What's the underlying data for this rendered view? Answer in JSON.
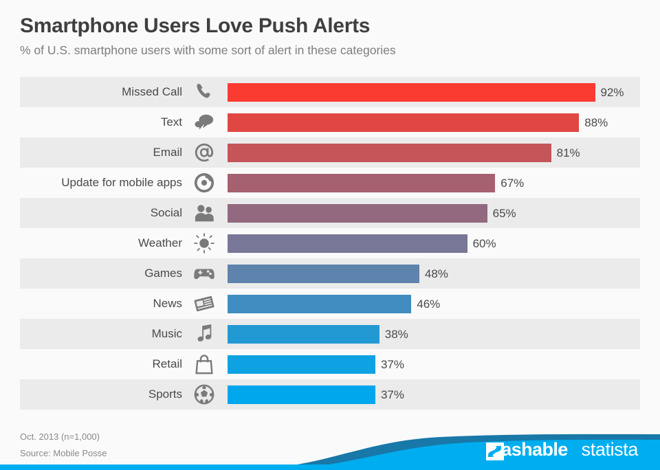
{
  "header": {
    "title": "Smartphone Users Love Push Alerts",
    "subtitle": "% of U.S. smartphone users with some sort of alert in these categories"
  },
  "footer": {
    "date_note": "Oct. 2013 (n=1,000)",
    "source": "Source: Mobile Posse",
    "mashable_label": "Mashable",
    "statista_label": "statista"
  },
  "colors": {
    "background": "#FAFAFA",
    "row_stripe": "#EBEBEB",
    "title": "#3F3F3F",
    "subtitle": "#7D7D7D",
    "label": "#4A4A4A",
    "icon": "#7A7A7A",
    "banner_light": "#00AEEF",
    "banner_dark": "#1878A8"
  },
  "chart_data": {
    "type": "bar",
    "orientation": "horizontal",
    "title": "Smartphone Users Love Push Alerts",
    "subtitle": "% of U.S. smartphone users with some sort of alert in these categories",
    "xlabel": "",
    "ylabel": "",
    "xlim": [
      0,
      100
    ],
    "unit": "%",
    "grid": false,
    "legend": "none",
    "categories": [
      "Missed Call",
      "Text",
      "Email",
      "Update for mobile apps",
      "Social",
      "Weather",
      "Games",
      "News",
      "Music",
      "Retail",
      "Sports"
    ],
    "values": [
      92,
      88,
      81,
      67,
      65,
      60,
      48,
      46,
      38,
      37,
      37
    ],
    "value_labels": [
      "92%",
      "88%",
      "81%",
      "67%",
      "65%",
      "60%",
      "48%",
      "46%",
      "38%",
      "37%",
      "37%"
    ],
    "bar_colors": [
      "#FA3B32",
      "#E04743",
      "#C55559",
      "#A5616F",
      "#92697F",
      "#797797",
      "#5E83AD",
      "#408CC0",
      "#2399D3",
      "#0FA2E2",
      "#00A7EC"
    ],
    "icons": [
      "phone-icon",
      "speech-bubble-icon",
      "at-sign-icon",
      "refresh-icon",
      "people-icon",
      "sun-icon",
      "gamepad-icon",
      "newspaper-icon",
      "music-note-icon",
      "shopping-bag-icon",
      "soccer-ball-icon"
    ]
  }
}
